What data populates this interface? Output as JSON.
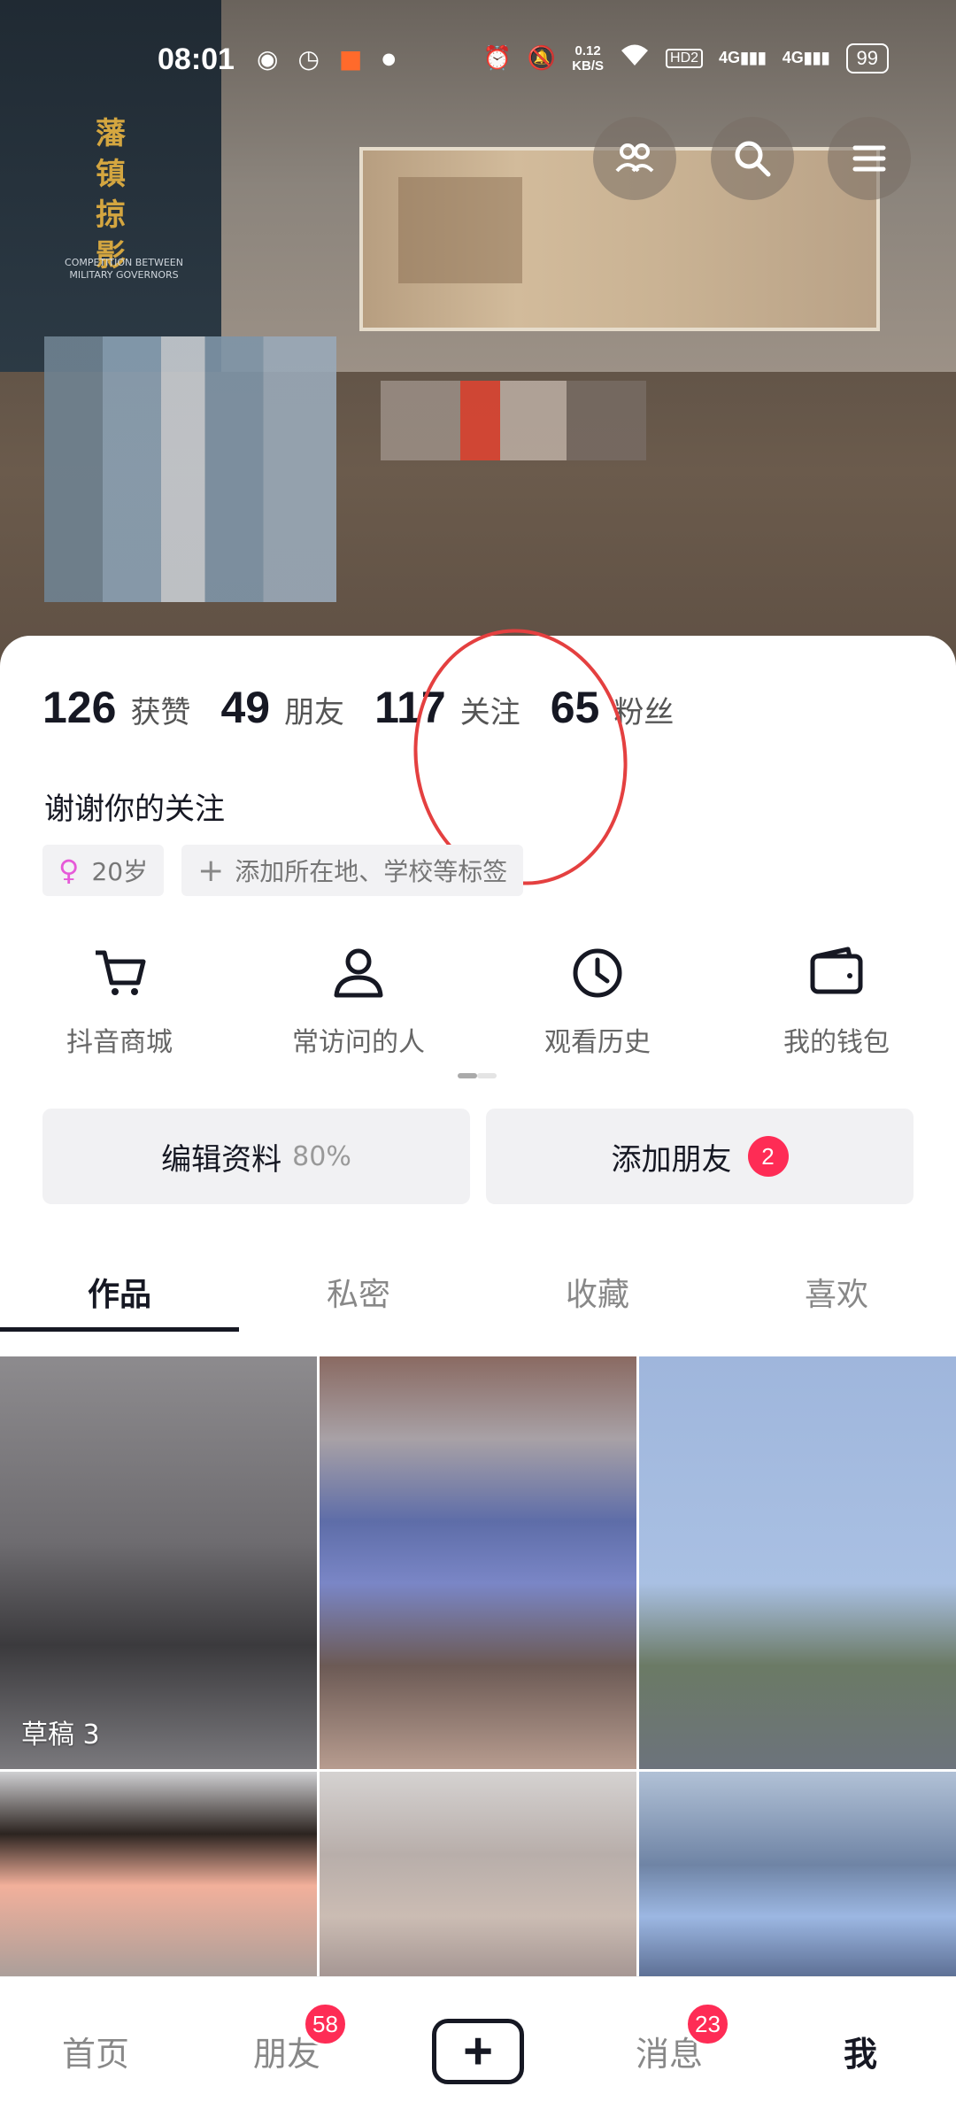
{
  "status_bar": {
    "time": "08:01",
    "net_speed_value": "0.12",
    "net_speed_unit": "KB/S",
    "network": "4G",
    "network2": "4G",
    "hd_label": "HD2",
    "battery": "99"
  },
  "cover": {
    "banner_title": "藩镇掠影",
    "banner_subtitle": "COMPETITION BETWEEN MILITARY GOVERNORS"
  },
  "top_buttons": {
    "friends_icon": "friends-icon",
    "search_icon": "search-icon",
    "menu_icon": "menu-icon"
  },
  "stats": [
    {
      "num": "126",
      "label": "获赞"
    },
    {
      "num": "49",
      "label": "朋友"
    },
    {
      "num": "117",
      "label": "关注"
    },
    {
      "num": "65",
      "label": "粉丝"
    }
  ],
  "bio": "谢谢你的关注",
  "tags": {
    "gender_icon": "♀",
    "age": "20岁",
    "add_plus": "+",
    "add_label": "添加所在地、学校等标签"
  },
  "shortcuts": [
    {
      "label": "抖音商城",
      "icon": "cart-icon"
    },
    {
      "label": "常访问的人",
      "icon": "person-icon"
    },
    {
      "label": "观看历史",
      "icon": "clock-icon"
    },
    {
      "label": "我的钱包",
      "icon": "wallet-icon"
    }
  ],
  "actions": {
    "edit_label": "编辑资料",
    "edit_progress": "80%",
    "add_friend_label": "添加朋友",
    "add_friend_badge": "2"
  },
  "tabs": [
    "作品",
    "私密",
    "收藏",
    "喜欢"
  ],
  "grid": {
    "draft_label": "草稿 3"
  },
  "bottom_nav": {
    "home": "首页",
    "friends": "朋友",
    "friends_badge": "58",
    "plus": "+",
    "messages": "消息",
    "messages_badge": "23",
    "me": "我"
  },
  "colors": {
    "accent_red": "#fe2c55",
    "annotation_circle": "#e44040",
    "text_primary": "#161823"
  }
}
